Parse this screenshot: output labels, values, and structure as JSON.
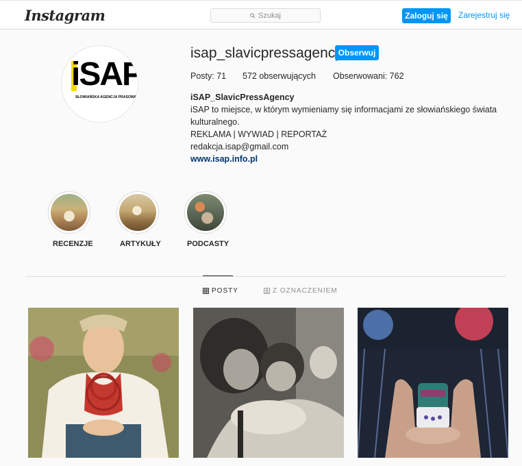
{
  "header": {
    "logo": "Instagram",
    "search_placeholder": "Szukaj",
    "login_label": "Zaloguj się",
    "register_label": "Zarejestruj się"
  },
  "profile": {
    "avatar_text": "iSAP",
    "avatar_subtitle": "SŁOWIAŃSKA AGENCJA PRASOWA",
    "username": "isap_slavicpressagency",
    "follow_label": "Obserwuj",
    "stats": {
      "posts": "Posty: 71",
      "followers": "572 obserwujących",
      "following": "Obserwowani: 762"
    },
    "bio": {
      "name": "iSAP_SlavicPressAgency",
      "line1": "iSAP to miejsce, w którym wymieniamy się informacjami ze słowiańskiego świata",
      "line2": "kulturalnego.",
      "line3": "REKLAMA | WYWIAD | REPORTAŻ",
      "line4": "redakcja.isap@gmail.com",
      "link": "www.isap.info.pl"
    }
  },
  "highlights": [
    {
      "label": "RECENZJE"
    },
    {
      "label": "ARTYKUŁY"
    },
    {
      "label": "PODCASTY"
    }
  ],
  "tabs": {
    "posts": "POSTY",
    "tagged": "Z OZNACZENIEM"
  },
  "colors": {
    "accent": "#0095f6",
    "link": "#00376b",
    "logo_yellow": "#f5d90a"
  }
}
